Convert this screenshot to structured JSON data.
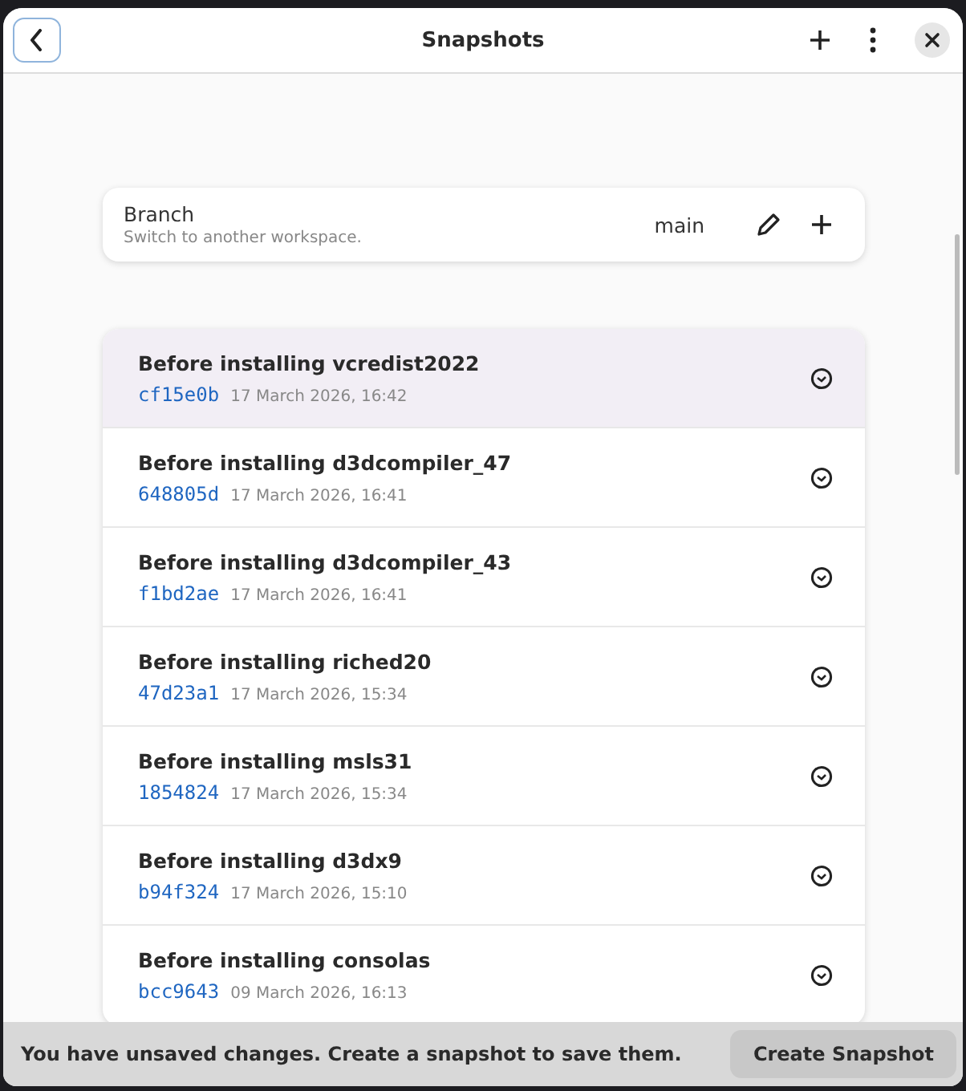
{
  "window": {
    "title": "Snapshots"
  },
  "branch": {
    "title": "Branch",
    "subtitle": "Switch to another workspace.",
    "value": "main"
  },
  "snapshots": [
    {
      "title": "Before installing vcredist2022",
      "hash": "cf15e0b",
      "date": "17 March 2026, 16:42",
      "selected": true
    },
    {
      "title": "Before installing d3dcompiler_47",
      "hash": "648805d",
      "date": "17 March 2026, 16:41",
      "selected": false
    },
    {
      "title": "Before installing d3dcompiler_43",
      "hash": "f1bd2ae",
      "date": "17 March 2026, 16:41",
      "selected": false
    },
    {
      "title": "Before installing riched20",
      "hash": "47d23a1",
      "date": "17 March 2026, 15:34",
      "selected": false
    },
    {
      "title": "Before installing msls31",
      "hash": "1854824",
      "date": "17 March 2026, 15:34",
      "selected": false
    },
    {
      "title": "Before installing d3dx9",
      "hash": "b94f324",
      "date": "17 March 2026, 15:10",
      "selected": false
    },
    {
      "title": "Before installing consolas",
      "hash": "bcc9643",
      "date": "09 March 2026, 16:13",
      "selected": false
    }
  ],
  "banner": {
    "message": "You have unsaved changes. Create a snapshot to save them.",
    "button": "Create Snapshot"
  }
}
